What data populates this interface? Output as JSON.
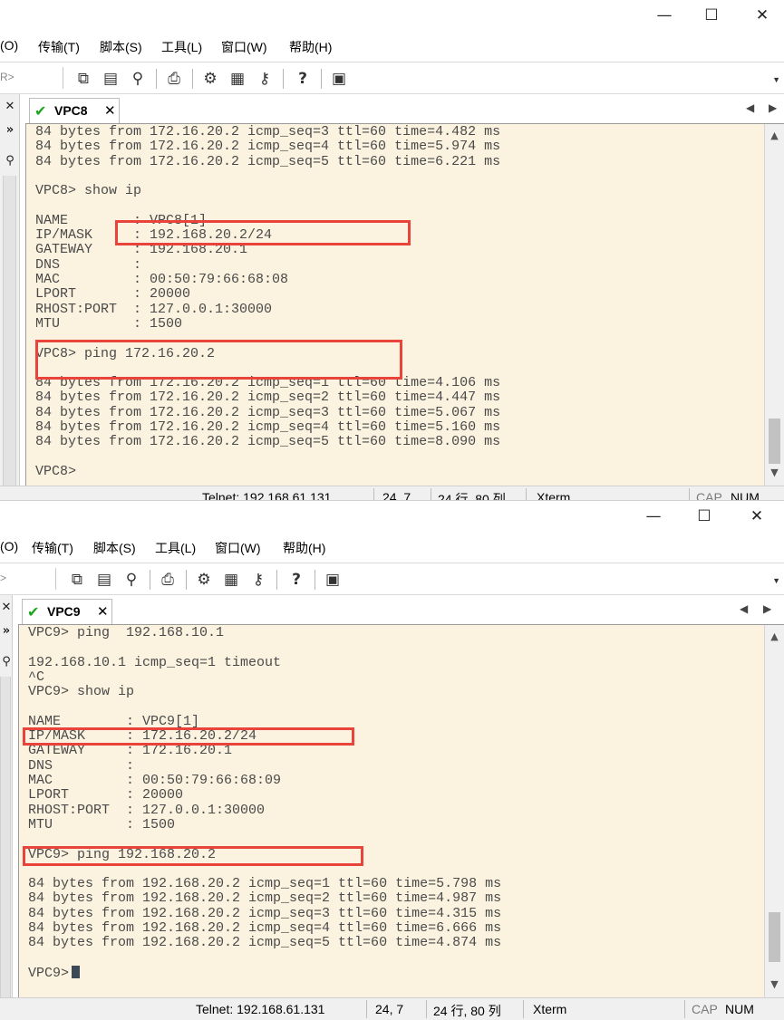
{
  "window_controls": {
    "minimize": "—",
    "maximize": "☐",
    "close": "✕"
  },
  "menu": [
    "(O)",
    "传输(T)",
    "脚本(S)",
    "工具(L)",
    "窗口(W)",
    "帮助(H)"
  ],
  "toolbar_session_1": "R>",
  "toolbar_session_2": ">",
  "left_pane": {
    "close": "✕",
    "expand": "»"
  },
  "toolbar_icons": [
    "copy-icon",
    "paste-icon",
    "find-icon",
    "print-icon",
    "settings-icon",
    "keymap-icon",
    "key-icon",
    "help-icon",
    "map-icon"
  ],
  "window1": {
    "tab": {
      "label": "VPC8",
      "close": "✕"
    },
    "terminal_lines": [
      "84 bytes from 172.16.20.2 icmp_seq=3 ttl=60 time=4.482 ms",
      "84 bytes from 172.16.20.2 icmp_seq=4 ttl=60 time=5.974 ms",
      "84 bytes from 172.16.20.2 icmp_seq=5 ttl=60 time=6.221 ms",
      "",
      "VPC8> show ip",
      "",
      "NAME        : VPC8[1]",
      "IP/MASK     : 192.168.20.2/24",
      "GATEWAY     : 192.168.20.1",
      "DNS         :",
      "MAC         : 00:50:79:66:68:08",
      "LPORT       : 20000",
      "RHOST:PORT  : 127.0.0.1:30000",
      "MTU         : 1500",
      "",
      "VPC8> ping 172.16.20.2",
      "",
      "84 bytes from 172.16.20.2 icmp_seq=1 ttl=60 time=4.106 ms",
      "84 bytes from 172.16.20.2 icmp_seq=2 ttl=60 time=4.447 ms",
      "84 bytes from 172.16.20.2 icmp_seq=3 ttl=60 time=5.067 ms",
      "84 bytes from 172.16.20.2 icmp_seq=4 ttl=60 time=5.160 ms",
      "84 bytes from 172.16.20.2 icmp_seq=5 ttl=60 time=8.090 ms",
      "",
      "VPC8>"
    ],
    "status": {
      "connection": "Telnet: 192.168.61.131",
      "cursor": "24,   7",
      "size": "24 行, 80 列",
      "term": "Xterm",
      "cap": "CAP",
      "num": "NUM"
    }
  },
  "window2": {
    "tab": {
      "label": "VPC9",
      "close": "✕"
    },
    "terminal_lines": [
      "VPC9> ping  192.168.10.1",
      "",
      "192.168.10.1 icmp_seq=1 timeout",
      "^C",
      "VPC9> show ip",
      "",
      "NAME        : VPC9[1]",
      "IP/MASK     : 172.16.20.2/24",
      "GATEWAY     : 172.16.20.1",
      "DNS         :",
      "MAC         : 00:50:79:66:68:09",
      "LPORT       : 20000",
      "RHOST:PORT  : 127.0.0.1:30000",
      "MTU         : 1500",
      "",
      "VPC9> ping 192.168.20.2",
      "",
      "84 bytes from 192.168.20.2 icmp_seq=1 ttl=60 time=5.798 ms",
      "84 bytes from 192.168.20.2 icmp_seq=2 ttl=60 time=4.987 ms",
      "84 bytes from 192.168.20.2 icmp_seq=3 ttl=60 time=4.315 ms",
      "84 bytes from 192.168.20.2 icmp_seq=4 ttl=60 time=6.666 ms",
      "84 bytes from 192.168.20.2 icmp_seq=5 ttl=60 time=4.874 ms",
      "",
      "VPC9>"
    ],
    "status": {
      "connection": "Telnet: 192.168.61.131",
      "cursor": "24,   7",
      "size": "24 行, 80 列",
      "term": "Xterm",
      "cap": "CAP",
      "num": "NUM"
    }
  },
  "colors": {
    "terminal_bg": "#fbf3df",
    "terminal_text": "#4a4a4a",
    "highlight_box": "#e8443c",
    "tab_check": "#1ea51e"
  }
}
